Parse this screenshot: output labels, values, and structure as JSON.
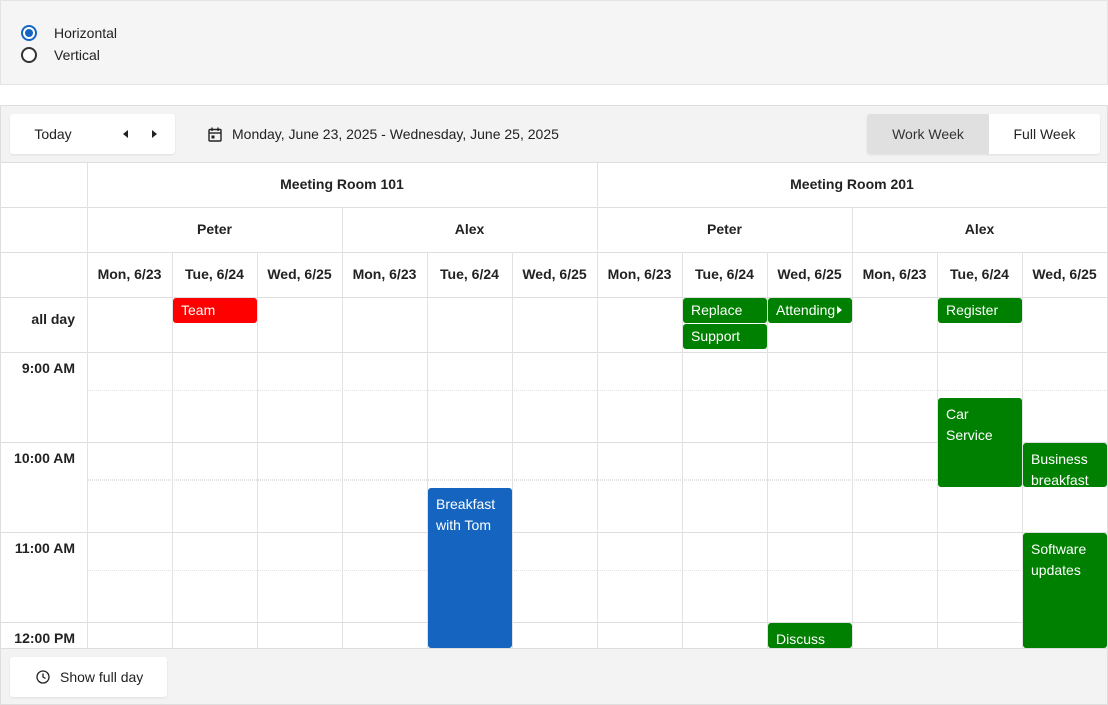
{
  "orientation": {
    "options": [
      {
        "label": "Horizontal",
        "checked": true
      },
      {
        "label": "Vertical",
        "checked": false
      }
    ]
  },
  "toolbar": {
    "today_label": "Today",
    "date_range": "Monday, June 23, 2025 - Wednesday, June 25, 2025",
    "views": [
      {
        "label": "Work Week",
        "active": true
      },
      {
        "label": "Full Week",
        "active": false
      }
    ]
  },
  "rooms": [
    "Meeting Room 101",
    "Meeting Room 201"
  ],
  "people": [
    "Peter",
    "Alex",
    "Peter",
    "Alex"
  ],
  "days": [
    "Mon, 6/23",
    "Tue, 6/24",
    "Wed, 6/25"
  ],
  "allday_label": "all day",
  "times": [
    "9:00 AM",
    "10:00 AM",
    "11:00 AM",
    "12:00 PM"
  ],
  "allday_events": [
    {
      "text": "Team",
      "color": "red",
      "col": 1,
      "row": 0
    },
    {
      "text": "Replace",
      "color": "green",
      "col": 7,
      "row": 0
    },
    {
      "text": "Support",
      "color": "green",
      "col": 7,
      "row": 1
    },
    {
      "text": "Attending",
      "color": "green",
      "col": 8,
      "row": 0,
      "continues": true
    },
    {
      "text": "Register",
      "color": "green",
      "col": 10,
      "row": 0
    }
  ],
  "events": [
    {
      "text": "Car Service",
      "color": "green",
      "col": 10,
      "start": 9.5,
      "end": 10.5
    },
    {
      "text": "Business breakfast with Caroline",
      "color": "green",
      "col": 11,
      "start": 10.0,
      "end": 10.5
    },
    {
      "text": "Breakfast with Tom",
      "color": "blue",
      "col": 4,
      "start": 10.5,
      "end": 12.5
    },
    {
      "text": "Software updates",
      "color": "green",
      "col": 11,
      "start": 11.0,
      "end": 12.5
    },
    {
      "text": "Discuss",
      "color": "green",
      "col": 8,
      "start": 12.0,
      "end": 12.5
    }
  ],
  "colors": {
    "green": "#008000",
    "red": "#ff0000",
    "blue": "#1565c0"
  },
  "bottom": {
    "show_full_day_label": "Show full day"
  },
  "icons": [
    "calendar-icon",
    "clock-icon",
    "chevron-left-icon",
    "chevron-right-icon"
  ]
}
